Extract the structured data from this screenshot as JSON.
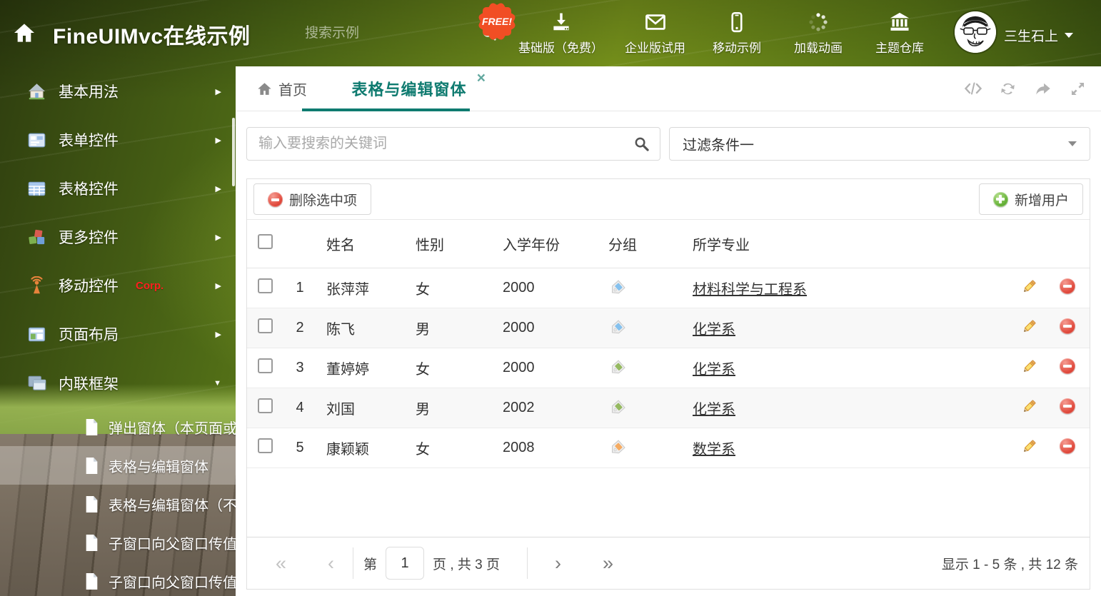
{
  "header": {
    "title": "FineUIMvc在线示例",
    "search_placeholder": "搜索示例",
    "free_badge": "FREE!",
    "nav_items": [
      {
        "label": "基础版（免费）",
        "icon": "download-icon"
      },
      {
        "label": "企业版试用",
        "icon": "envelope-icon"
      },
      {
        "label": "移动示例",
        "icon": "mobile-icon"
      },
      {
        "label": "加载动画",
        "icon": "spinner-icon"
      },
      {
        "label": "主题仓库",
        "icon": "bank-icon"
      }
    ],
    "username": "三生石上"
  },
  "sidebar": {
    "items": [
      {
        "label": "基本用法"
      },
      {
        "label": "表单控件"
      },
      {
        "label": "表格控件"
      },
      {
        "label": "更多控件"
      },
      {
        "label": "移动控件",
        "badge": "Corp."
      },
      {
        "label": "页面布局"
      },
      {
        "label": "内联框架"
      }
    ],
    "subitems": [
      {
        "label": "弹出窗体（本页面或..."
      },
      {
        "label": "表格与编辑窗体"
      },
      {
        "label": "表格与编辑窗体（不..."
      },
      {
        "label": "子窗口向父窗口传值"
      },
      {
        "label": "子窗口向父窗口传值..."
      }
    ]
  },
  "tabs": {
    "home_label": "首页",
    "active_label": "表格与编辑窗体",
    "close_icon": "×"
  },
  "filters": {
    "search_placeholder": "输入要搜索的关键词",
    "filter_selected": "过滤条件一"
  },
  "actions": {
    "delete_label": "删除选中项",
    "add_label": "新增用户"
  },
  "table": {
    "columns": [
      "姓名",
      "性别",
      "入学年份",
      "分组",
      "所学专业"
    ],
    "rows": [
      {
        "num": "1",
        "name": "张萍萍",
        "gender": "女",
        "year": "2000",
        "tag_color": "#85c1ee",
        "major": "材料科学与工程系"
      },
      {
        "num": "2",
        "name": "陈飞",
        "gender": "男",
        "year": "2000",
        "tag_color": "#85c1ee",
        "major": "化学系"
      },
      {
        "num": "3",
        "name": "董婷婷",
        "gender": "女",
        "year": "2000",
        "tag_color": "#95b961",
        "major": "化学系"
      },
      {
        "num": "4",
        "name": "刘国",
        "gender": "男",
        "year": "2002",
        "tag_color": "#95b961",
        "major": "化学系"
      },
      {
        "num": "5",
        "name": "康颖颖",
        "gender": "女",
        "year": "2008",
        "tag_color": "#f5ab62",
        "major": "数学系"
      }
    ]
  },
  "pagination": {
    "first_icon": "«",
    "prev_icon": "‹",
    "next_icon": "›",
    "last_icon": "»",
    "page_prefix": "第",
    "page_value": "1",
    "page_suffix": "页 , 共 3 页",
    "summary": "显示 1 - 5 条 , 共 12 条"
  },
  "icons": {
    "arrow_right": "▶",
    "arrow_down": "▼"
  },
  "colors": {
    "accent_teal": "#0f7b70",
    "free_badge_orange": "#f14e24",
    "delete_red": "#e14b3e",
    "add_green": "#67b239",
    "corp_badge_red": "#ff1f1f",
    "tag_blue": "#85c1ee",
    "tag_green": "#95b961",
    "tag_orange": "#f5ab62"
  }
}
